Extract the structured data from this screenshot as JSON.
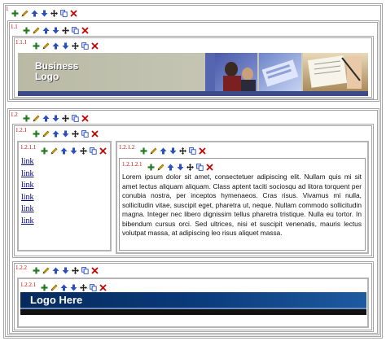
{
  "labels": {
    "root": "1",
    "r1": "1.1",
    "r1_1": "1.1.1",
    "r2": "1.2",
    "r2_1": "1.2.1",
    "r2_1_1": "1.2.1.1",
    "r2_1_2": "1.2.1.2",
    "r2_1_2_1": "1.2.1.2.1",
    "r2_2": "1.2.2",
    "r2_2_1": "1.2.2.1"
  },
  "toolbar_icons": [
    "add-icon",
    "edit-pencil-icon",
    "move-up-icon",
    "move-down-icon",
    "move-icon",
    "copy-icon",
    "delete-icon"
  ],
  "colors": {
    "add": "#1f7a1f",
    "edit": "#d9a300",
    "arrow": "#2b4fbf",
    "delete": "#cc0000",
    "label": "#cc0000",
    "logo_bg": "#062a5c"
  },
  "business_logo": {
    "line1": "Business",
    "line2": "Logo"
  },
  "links": [
    "link",
    "link",
    "link",
    "link",
    "link",
    "link"
  ],
  "lorem": "Lorem ipsum dolor sit amet, consectetuer adipiscing elit. Nullam quis mi sit amet lectus aliquam aliquam. Class aptent taciti sociosqu ad litora torquent per conubia nostra, per inceptos hymenaeos. Cras risus. Vivamus mi nulla, sollicitudin vitae, suscipit eget, pharetra ut, neque. Nullam commodo sollicitudin magna. Integer nec libero dignissim tellus pharetra tristique. Nulla eu tortor. In bibendum cursus orci. Sed ultrices, nisi et suscipit venenatis, mauris lectus volutpat massa, at adipiscing leo risus aliquet massa.",
  "footer_logo": {
    "text": "Logo Here"
  }
}
